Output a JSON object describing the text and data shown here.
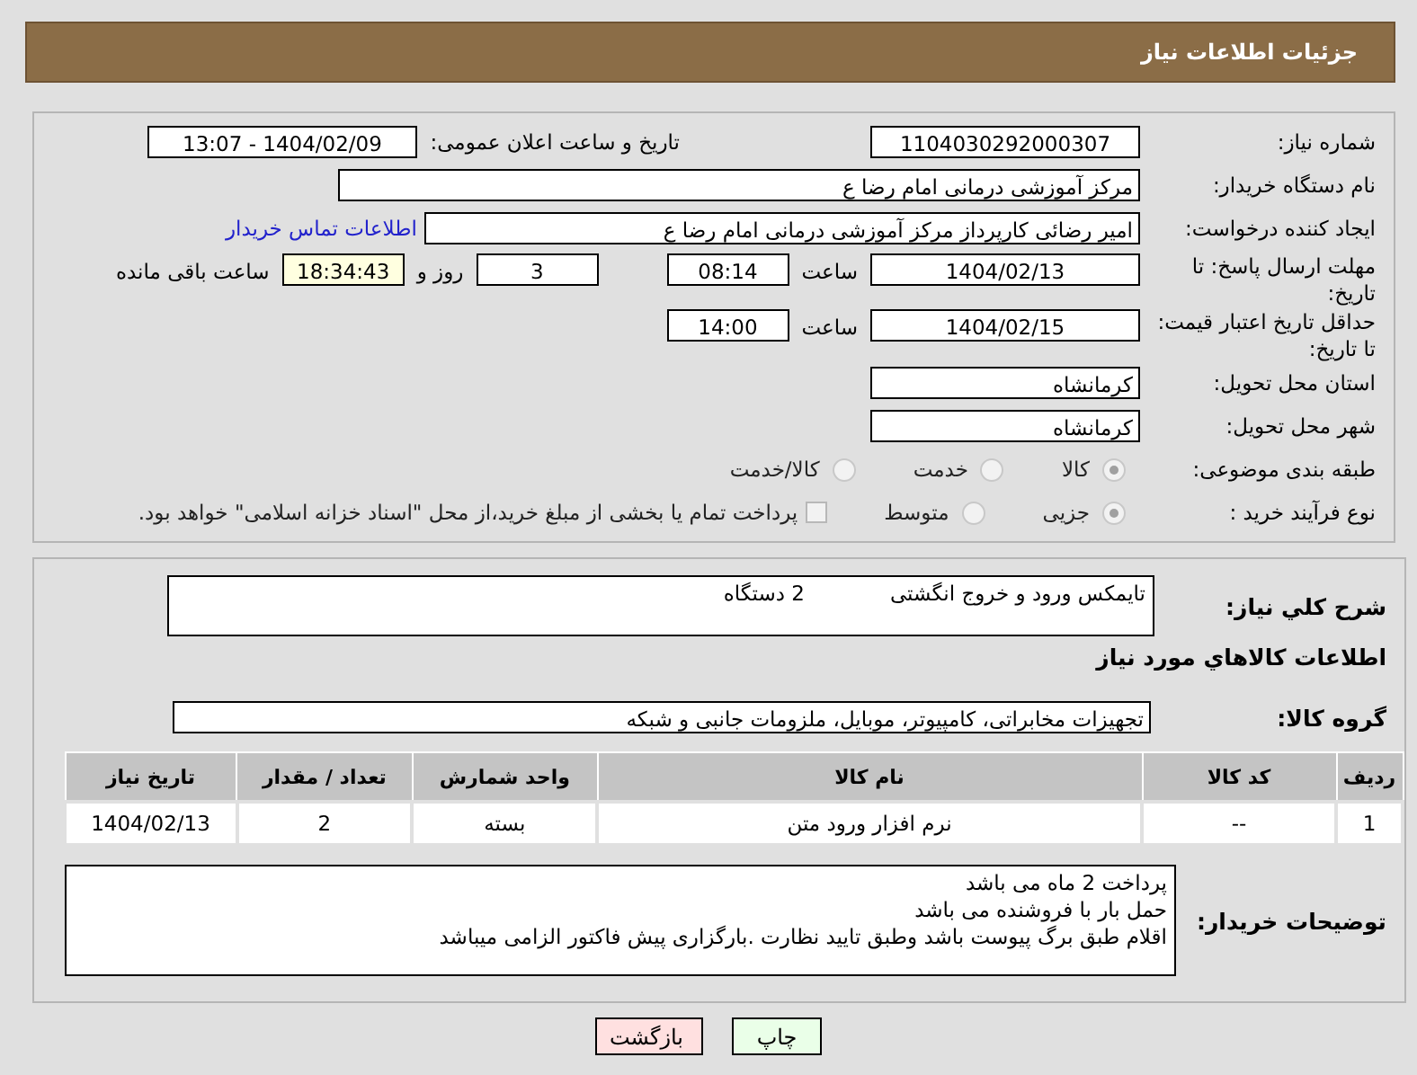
{
  "header": {
    "title": "جزئیات اطلاعات نیاز"
  },
  "need_number": {
    "label": "شماره نیاز:",
    "value": "1104030292000307"
  },
  "announce": {
    "label": "تاریخ و ساعت اعلان عمومی:",
    "value": "1404/02/09 - 13:07"
  },
  "buyer_org": {
    "label": "نام دستگاه خریدار:",
    "value": "مرکز آموزشی  درمانی امام رضا  ع"
  },
  "requester": {
    "label": "ایجاد کننده درخواست:",
    "value": "امیر رضائی کارپرداز مرکز آموزشی  درمانی امام رضا  ع",
    "link": "اطلاعات تماس خریدار"
  },
  "deadline": {
    "label": "مهلت ارسال پاسخ: تا تاریخ:",
    "date": "1404/02/13",
    "time_label": "ساعت",
    "time": "08:14",
    "days": "3",
    "days_label": "روز و",
    "remaining": "18:34:43",
    "remaining_label": "ساعت باقی مانده"
  },
  "validity": {
    "label": "حداقل تاریخ اعتبار قیمت: تا تاریخ:",
    "date": "1404/02/15",
    "time_label": "ساعت",
    "time": "14:00"
  },
  "province": {
    "label": "استان محل تحویل:",
    "value": "کرمانشاه"
  },
  "city": {
    "label": "شهر محل تحویل:",
    "value": "کرمانشاه"
  },
  "category": {
    "label": "طبقه بندی موضوعی:",
    "options": [
      {
        "label": "کالا",
        "selected": true
      },
      {
        "label": "خدمت",
        "selected": false
      },
      {
        "label": "کالا/خدمت",
        "selected": false
      }
    ]
  },
  "process": {
    "label": "نوع فرآیند خرید :",
    "options": [
      {
        "label": "جزیی",
        "selected": true
      },
      {
        "label": "متوسط",
        "selected": false
      }
    ],
    "payment": {
      "label": "پرداخت تمام یا بخشی از مبلغ خرید،از محل \"اسناد خزانه اسلامی\" خواهد بود.",
      "checked": false
    }
  },
  "description": {
    "label": "شرح کلي نياز:",
    "value": "تایمکس ورود و خروج انگشتی             2 دستگاه"
  },
  "goods_title": "اطلاعات كالاهاي مورد نياز",
  "goods_group": {
    "label": "گروه کالا:",
    "value": "تجهیزات مخابراتی، کامپیوتر، موبایل، ملزومات جانبی و شبکه"
  },
  "table": {
    "columns": [
      "ردیف",
      "کد کالا",
      "نام کالا",
      "واحد شمارش",
      "تعداد / مقدار",
      "تاریخ نیاز"
    ],
    "rows": [
      [
        "1",
        "--",
        "نرم افزار ورود متن",
        "بسته",
        "2",
        "1404/02/13"
      ]
    ]
  },
  "buyer_notes": {
    "label": "توضیحات خریدار:",
    "lines": [
      "پرداخت 2 ماه می باشد",
      "حمل بار با فروشنده می باشد",
      "اقلام طبق برگ پیوست باشد وطبق تایید نظارت .بارگزاری پیش فاکتور الزامی میباشد"
    ]
  },
  "buttons": [
    {
      "label": "چاپ",
      "kind": "print"
    },
    {
      "label": "بازگشت",
      "kind": "back"
    }
  ]
}
